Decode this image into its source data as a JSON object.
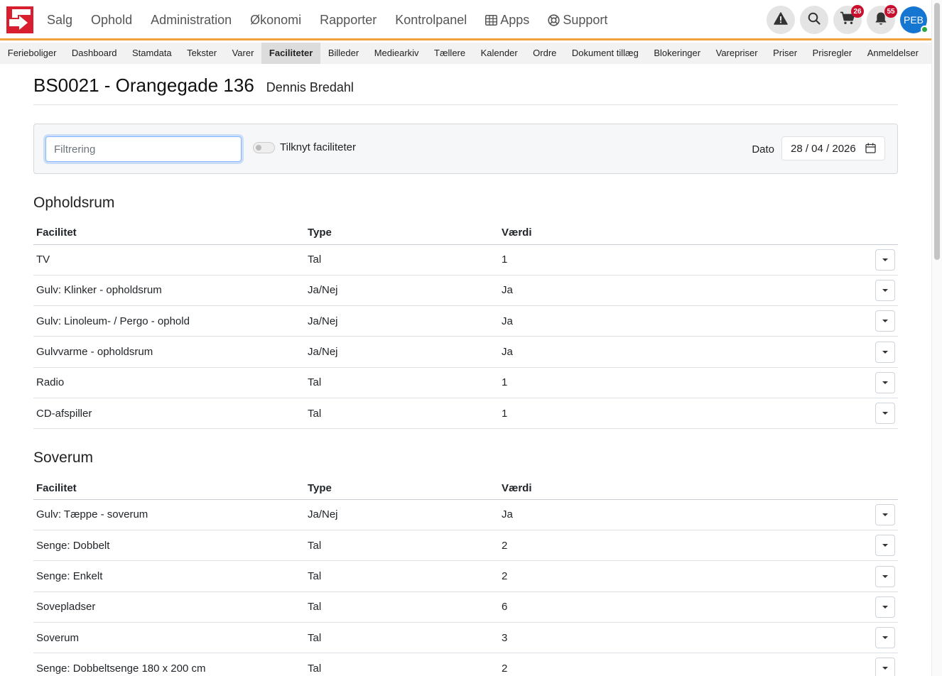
{
  "nav": {
    "items": [
      "Salg",
      "Ophold",
      "Administration",
      "Økonomi",
      "Rapporter",
      "Kontrolpanel",
      "Apps",
      "Support"
    ],
    "cart_count": "26",
    "notification_count": "55",
    "avatar_initials": "PEB"
  },
  "subnav": {
    "items": [
      "Ferieboliger",
      "Dashboard",
      "Stamdata",
      "Tekster",
      "Varer",
      "Faciliteter",
      "Billeder",
      "Mediearkiv",
      "Tællere",
      "Kalender",
      "Ordre",
      "Dokument tillæg",
      "Blokeringer",
      "Varepriser",
      "Priser",
      "Prisregler",
      "Anmeldelser"
    ],
    "active": "Faciliteter"
  },
  "page": {
    "title": "BS0021 - Orangegade 136",
    "owner": "Dennis Bredahl"
  },
  "filter": {
    "placeholder": "Filtrering",
    "toggle_label": "Tilknyt faciliteter",
    "date_label": "Dato",
    "date_value": "28 / 04 / 2026"
  },
  "columns": {
    "facility": "Facilitet",
    "type": "Type",
    "value": "Værdi"
  },
  "sections": [
    {
      "title": "Opholdsrum",
      "rows": [
        {
          "facility": "TV",
          "type": "Tal",
          "value": "1"
        },
        {
          "facility": "Gulv: Klinker - opholdsrum",
          "type": "Ja/Nej",
          "value": "Ja"
        },
        {
          "facility": "Gulv: Linoleum- / Pergo - ophold",
          "type": "Ja/Nej",
          "value": "Ja"
        },
        {
          "facility": "Gulvvarme - opholdsrum",
          "type": "Ja/Nej",
          "value": "Ja"
        },
        {
          "facility": "Radio",
          "type": "Tal",
          "value": "1"
        },
        {
          "facility": "CD-afspiller",
          "type": "Tal",
          "value": "1"
        }
      ]
    },
    {
      "title": "Soverum",
      "rows": [
        {
          "facility": "Gulv: Tæppe - soverum",
          "type": "Ja/Nej",
          "value": "Ja"
        },
        {
          "facility": "Senge: Dobbelt",
          "type": "Tal",
          "value": "2"
        },
        {
          "facility": "Senge: Enkelt",
          "type": "Tal",
          "value": "2"
        },
        {
          "facility": "Sovepladser",
          "type": "Tal",
          "value": "6"
        },
        {
          "facility": "Soverum",
          "type": "Tal",
          "value": "3"
        },
        {
          "facility": "Senge: Dobbeltsenge 180 x 200 cm",
          "type": "Tal",
          "value": "2"
        }
      ]
    }
  ],
  "colors": {
    "accent": "#f0a33a",
    "brand": "#d71f30",
    "badge": "#c8102e",
    "avatar": "#1576d1"
  }
}
